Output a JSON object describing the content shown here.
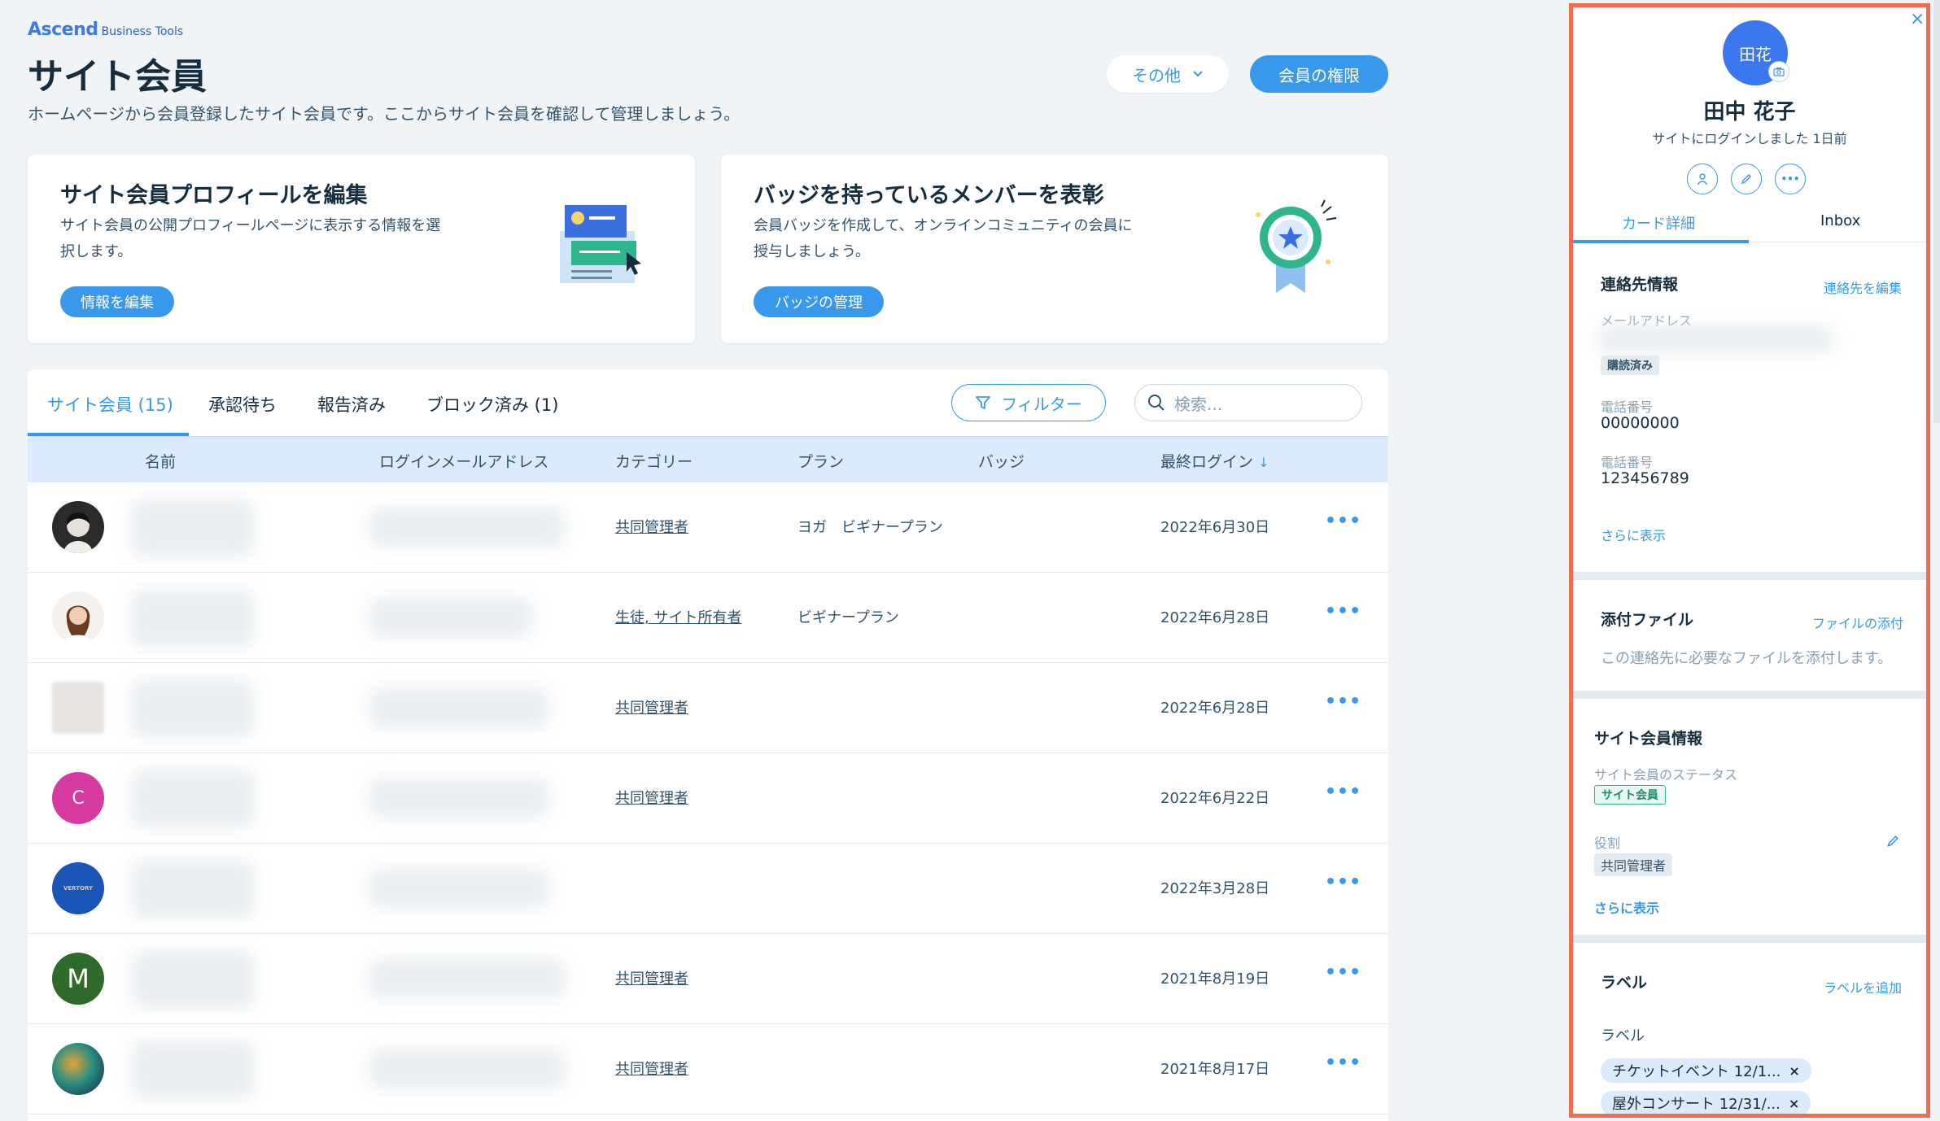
{
  "header": {
    "brand": "Ascend",
    "brand_sub": "Business Tools",
    "title": "サイト会員",
    "subtitle": "ホームページから会員登録したサイト会員です。ここからサイト会員を確認して管理しましょう。",
    "other_button": "その他",
    "permissions_button": "会員の権限"
  },
  "cards": [
    {
      "title": "サイト会員プロフィールを編集",
      "desc_line1": "サイト会員の公開プロフィールページに表示する情報を選",
      "desc_line2": "択します。",
      "button": "情報を編集"
    },
    {
      "title": "バッジを持っているメンバーを表彰",
      "desc_line1": "会員バッジを作成して、オンラインコミュニティの会員に",
      "desc_line2": "授与しましょう。",
      "button": "バッジの管理"
    }
  ],
  "tabs": [
    "サイト会員 (15)",
    "承認待ち",
    "報告済み",
    "ブロック済み (1)"
  ],
  "filter_button": "フィルター",
  "search_placeholder": "検索...",
  "columns": [
    "名前",
    "ログインメールアドレス",
    "カテゴリー",
    "プラン",
    "バッジ",
    "最終ログイン"
  ],
  "sort_arrow": "↓",
  "rows": [
    {
      "category": "共同管理者",
      "plan": "ヨガ　ビギナープラン",
      "last_login": "2022年6月30日"
    },
    {
      "category": "生徒, サイト所有者",
      "plan": "ビギナープラン",
      "last_login": "2022年6月28日"
    },
    {
      "category": "共同管理者",
      "plan": "",
      "last_login": "2022年6月28日"
    },
    {
      "category": "共同管理者",
      "plan": "",
      "last_login": "2022年6月22日",
      "avatar_letter": "C"
    },
    {
      "category": "",
      "plan": "",
      "last_login": "2022年3月28日",
      "avatar_text": "VERTORY"
    },
    {
      "category": "共同管理者",
      "plan": "",
      "last_login": "2021年8月19日",
      "avatar_letter": "M"
    },
    {
      "category": "共同管理者",
      "plan": "",
      "last_login": "2021年8月17日"
    }
  ],
  "row_more": "•••",
  "panel": {
    "avatar_initials": "田花",
    "name": "田中 花子",
    "last_login_text": "サイトにログインしました 1日前",
    "tab_details": "カード詳細",
    "tab_inbox": "Inbox",
    "close": "×",
    "contact": {
      "title": "連絡先情報",
      "edit_link": "連絡先を編集",
      "email_label": "メールアドレス",
      "subscribed_tag": "購読済み",
      "phone_label_1": "電話番号",
      "phone_1": "00000000",
      "phone_label_2": "電話番号",
      "phone_2": "123456789",
      "show_more": "さらに表示"
    },
    "files": {
      "title": "添付ファイル",
      "attach_link": "ファイルの添付",
      "empty_text": "この連絡先に必要なファイルを添付します。"
    },
    "member_info": {
      "title": "サイト会員情報",
      "status_label": "サイト会員のステータス",
      "status_tag": "サイト会員",
      "role_label": "役割",
      "role_tag": "共同管理者",
      "show_more": "さらに表示"
    },
    "labels": {
      "title": "ラベル",
      "add_link": "ラベルを追加",
      "sub_title": "ラベル",
      "chips": [
        "チケットイベント 12/1...",
        "屋外コンサート 12/31/..."
      ],
      "chip_remove": "×"
    }
  }
}
